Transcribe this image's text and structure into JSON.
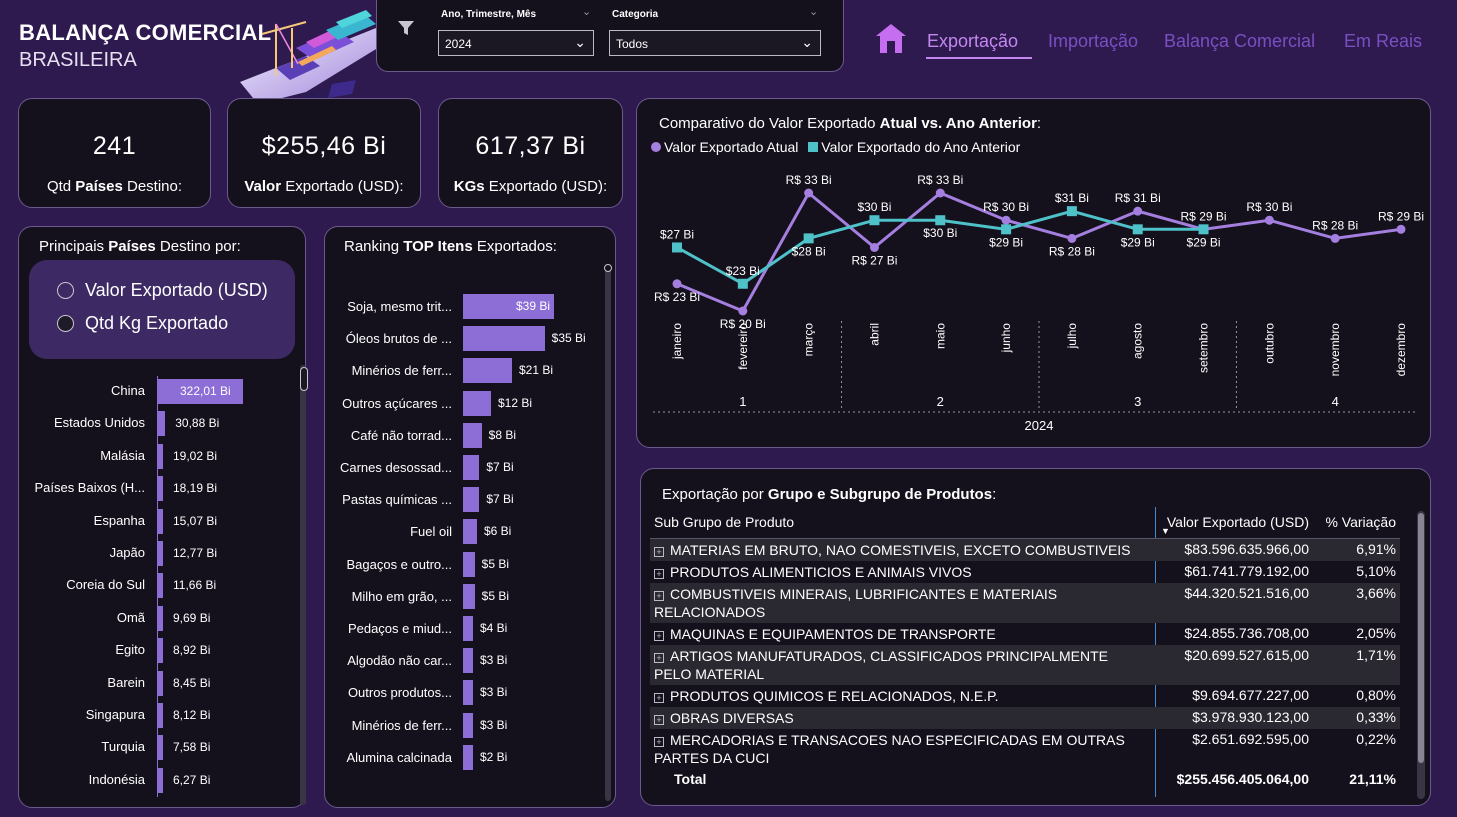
{
  "header": {
    "title_line1": "BALANÇA COMERCIAL",
    "title_line2": "BRASILEIRA"
  },
  "filters": {
    "period_label": "Ano, Trimestre, Mês",
    "period_value": "2024",
    "category_label": "Categoria",
    "category_value": "Todos"
  },
  "nav": {
    "tabs": [
      "Exportação",
      "Importação",
      "Balança Comercial",
      "Em Reais"
    ],
    "active": "Exportação"
  },
  "kpis": [
    {
      "value": "241",
      "label_bold": "",
      "label_prefix": "Qtd ",
      "label_bold_word": "Países",
      "label_suffix": " Destino:"
    },
    {
      "value": "$255,46 Bi",
      "label_prefix": "",
      "label_bold_word": "Valor",
      "label_suffix": " Exportado (USD):"
    },
    {
      "value": "617,37 Bi",
      "label_prefix": "",
      "label_bold_word": "KGs",
      "label_suffix": " Exportado (USD):"
    }
  ],
  "countries_panel": {
    "title_prefix": "Principais ",
    "title_bold": "Países",
    "title_suffix": " Destino por:",
    "options": [
      "Valor Exportado (USD)",
      "Qtd Kg Exportado"
    ],
    "selected_option": "Qtd Kg Exportado",
    "items": [
      {
        "label": "China",
        "value": 322.01,
        "text": "322,01 Bi"
      },
      {
        "label": "Estados Unidos",
        "value": 30.88,
        "text": "30,88 Bi"
      },
      {
        "label": "Malásia",
        "value": 19.02,
        "text": "19,02 Bi"
      },
      {
        "label": "Países Baixos (H...",
        "value": 18.19,
        "text": "18,19 Bi"
      },
      {
        "label": "Espanha",
        "value": 15.07,
        "text": "15,07 Bi"
      },
      {
        "label": "Japão",
        "value": 12.77,
        "text": "12,77 Bi"
      },
      {
        "label": "Coreia do Sul",
        "value": 11.66,
        "text": "11,66 Bi"
      },
      {
        "label": "Omã",
        "value": 9.69,
        "text": "9,69 Bi"
      },
      {
        "label": "Egito",
        "value": 8.92,
        "text": "8,92 Bi"
      },
      {
        "label": "Barein",
        "value": 8.45,
        "text": "8,45 Bi"
      },
      {
        "label": "Singapura",
        "value": 8.12,
        "text": "8,12 Bi"
      },
      {
        "label": "Turquia",
        "value": 7.58,
        "text": "7,58 Bi"
      },
      {
        "label": "Indonésia",
        "value": 6.27,
        "text": "6,27 Bi"
      }
    ]
  },
  "ranking_panel": {
    "title_prefix": "Ranking ",
    "title_bold": "TOP Itens",
    "title_suffix": " Exportados:",
    "items": [
      {
        "label": "Soja, mesmo trit...",
        "value": 39,
        "text": "$39 Bi"
      },
      {
        "label": "Óleos brutos de ...",
        "value": 35,
        "text": "$35 Bi"
      },
      {
        "label": "Minérios de ferr...",
        "value": 21,
        "text": "$21 Bi"
      },
      {
        "label": "Outros açúcares ...",
        "value": 12,
        "text": "$12 Bi"
      },
      {
        "label": "Café não torrad...",
        "value": 8,
        "text": "$8 Bi"
      },
      {
        "label": "Carnes desossad...",
        "value": 7,
        "text": "$7 Bi"
      },
      {
        "label": "Pastas químicas ...",
        "value": 7,
        "text": "$7 Bi"
      },
      {
        "label": "Fuel oil",
        "value": 6,
        "text": "$6 Bi"
      },
      {
        "label": "Bagaços e outro...",
        "value": 5,
        "text": "$5 Bi"
      },
      {
        "label": "Milho em grão, ...",
        "value": 5,
        "text": "$5 Bi"
      },
      {
        "label": "Pedaços e miud...",
        "value": 4,
        "text": "$4 Bi"
      },
      {
        "label": "Algodão não car...",
        "value": 3,
        "text": "$3 Bi"
      },
      {
        "label": "Outros produtos...",
        "value": 3,
        "text": "$3 Bi"
      },
      {
        "label": "Minérios de ferr...",
        "value": 3,
        "text": "$3 Bi"
      },
      {
        "label": "Alumina calcinada",
        "value": 2,
        "text": "$2 Bi"
      }
    ]
  },
  "chart_data": {
    "type": "line",
    "title_prefix": "Comparativo do Valor Exportado ",
    "title_bold": "Atual vs. Ano Anterior",
    "title_suffix": ":",
    "categories": [
      "janeiro",
      "fevereiro",
      "março",
      "abril",
      "maio",
      "junho",
      "julho",
      "agosto",
      "setembro",
      "outubro",
      "novembro",
      "dezembro"
    ],
    "quarters": [
      "1",
      "2",
      "3",
      "4"
    ],
    "year": "2024",
    "series": [
      {
        "name": "Valor Exportado Atual",
        "color": "#a57fe0",
        "values": [
          23,
          20,
          33,
          27,
          33,
          30,
          28,
          31,
          29,
          30,
          28,
          29
        ],
        "labels": [
          "R$ 23 Bi",
          "R$ 20 Bi",
          "R$ 33 Bi",
          "R$ 27 Bi",
          "R$ 33 Bi",
          "R$ 30 Bi",
          "R$ 28 Bi",
          "R$ 31 Bi",
          "R$ 29 Bi",
          "R$ 30 Bi",
          "R$ 28 Bi",
          "R$ 29 Bi"
        ]
      },
      {
        "name": "Valor Exportado do Ano Anterior",
        "color": "#4fc1c8",
        "values": [
          27,
          23,
          28,
          30,
          30,
          29,
          31,
          29,
          29,
          null,
          null,
          null
        ],
        "labels": [
          "$27 Bi",
          "$23 Bi",
          "$28 Bi",
          "$30 Bi",
          "$30 Bi",
          "$29 Bi",
          "$31 Bi",
          "$29 Bi",
          "$29 Bi",
          "",
          "",
          ""
        ]
      }
    ]
  },
  "table_panel": {
    "title_prefix": "Exportação por ",
    "title_bold": "Grupo e Subgrupo de Produtos",
    "title_suffix": ":",
    "columns": [
      "Sub Grupo de Produto",
      "Valor Exportado (USD)",
      "% Variação"
    ],
    "rows": [
      {
        "name": "MATERIAS EM BRUTO, NAO COMESTIVEIS, EXCETO COMBUSTIVEIS",
        "value": "$83.596.635.966,00",
        "pct": "6,91%"
      },
      {
        "name": "PRODUTOS ALIMENTICIOS E ANIMAIS VIVOS",
        "value": "$61.741.779.192,00",
        "pct": "5,10%"
      },
      {
        "name": "COMBUSTIVEIS MINERAIS, LUBRIFICANTES E MATERIAIS RELACIONADOS",
        "value": "$44.320.521.516,00",
        "pct": "3,66%"
      },
      {
        "name": "MAQUINAS E EQUIPAMENTOS DE TRANSPORTE",
        "value": "$24.855.736.708,00",
        "pct": "2,05%"
      },
      {
        "name": "ARTIGOS MANUFATURADOS, CLASSIFICADOS PRINCIPALMENTE PELO MATERIAL",
        "value": "$20.699.527.615,00",
        "pct": "1,71%"
      },
      {
        "name": "PRODUTOS QUIMICOS E RELACIONADOS, N.E.P.",
        "value": "$9.694.677.227,00",
        "pct": "0,80%"
      },
      {
        "name": "OBRAS DIVERSAS",
        "value": "$3.978.930.123,00",
        "pct": "0,33%"
      },
      {
        "name": "MERCADORIAS E TRANSACOES NAO ESPECIFICADAS EM OUTRAS PARTES DA CUCI",
        "value": "$2.651.692.595,00",
        "pct": "0,22%"
      }
    ],
    "total": {
      "name": "Total",
      "value": "$255.456.405.064,00",
      "pct": "21,11%"
    }
  }
}
